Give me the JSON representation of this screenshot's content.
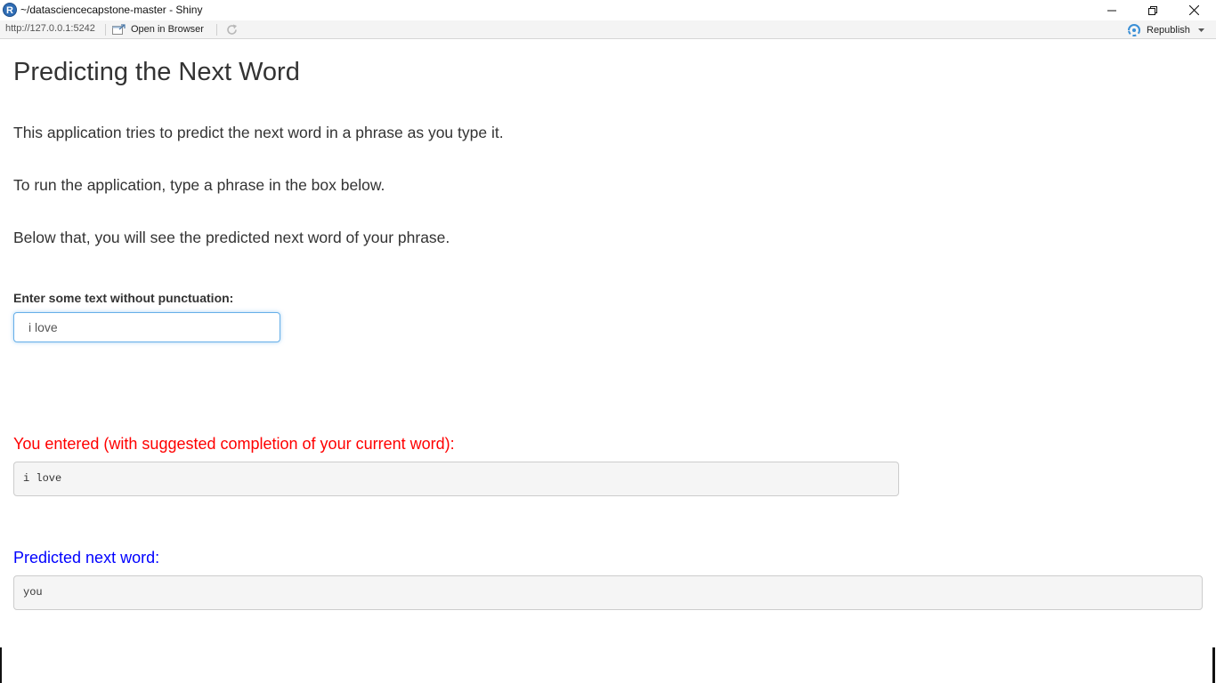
{
  "window": {
    "title": "~/datasciencecapstone-master - Shiny",
    "logo_letter": "R"
  },
  "toolbar": {
    "url": "http://127.0.0.1:5242",
    "open_in_browser": "Open in Browser",
    "republish": "Republish"
  },
  "page": {
    "title": "Predicting the Next Word",
    "paragraphs": [
      "This application tries to predict the next word in a phrase as you type it.",
      "To run the application, type a phrase in the box below.",
      "Below that, you will see the predicted next word of your phrase."
    ],
    "input": {
      "label": "Enter some text without punctuation:",
      "value": "i love "
    },
    "entered": {
      "heading": "You entered (with suggested completion of your current word):",
      "value": "i love"
    },
    "predicted": {
      "heading": "Predicted next word:",
      "value": "you"
    }
  },
  "colors": {
    "entered_heading": "#ff0000",
    "predicted_heading": "#0000ff",
    "input_focus_border": "#66afe9",
    "toolbar_bg": "#f4f4f4"
  },
  "icons": {
    "logo": "r-logo-icon",
    "minimize": "minimize-icon",
    "maximize": "restore-icon",
    "close": "close-icon",
    "open_in_browser": "open-in-browser-icon",
    "refresh": "refresh-icon",
    "republish": "publish-icon",
    "dropdown": "chevron-down-icon"
  }
}
